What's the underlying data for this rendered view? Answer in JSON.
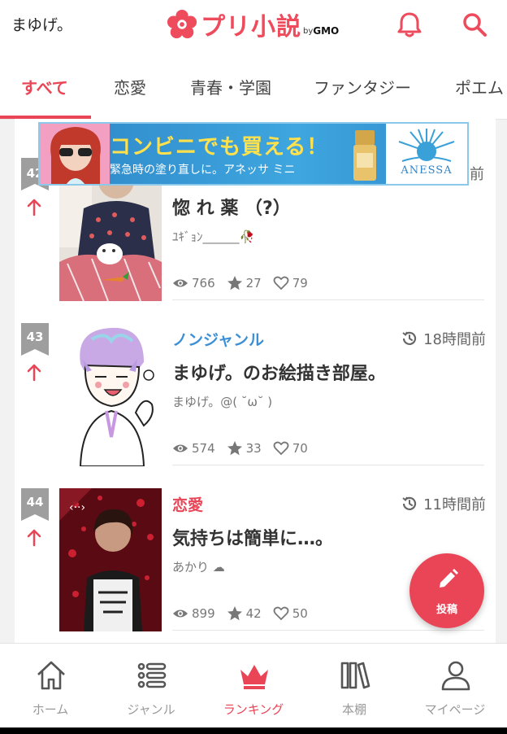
{
  "header": {
    "user_name": "まゆげ。",
    "logo_text": "プリ小説",
    "logo_by": "by",
    "logo_gmo": "GMO",
    "icons": [
      "bell-icon",
      "search-icon"
    ]
  },
  "tabs": [
    {
      "label": "すべて",
      "active": true
    },
    {
      "label": "恋愛"
    },
    {
      "label": "青春・学園"
    },
    {
      "label": "ファンタジー"
    },
    {
      "label": "ポエム"
    }
  ],
  "ad": {
    "headline": "コンビニでも買える！",
    "sub": "緊急時の塗り直しに。アネッサ ミニ",
    "brand": "ANESSA",
    "partial_time": "前"
  },
  "items": [
    {
      "rank": "42",
      "genre": "",
      "time": "",
      "title": "惚 れ 薬 （?）",
      "author": "ﾕｷﾞｮﾝ______🥀",
      "views": "766",
      "stars": "27",
      "likes": "79"
    },
    {
      "rank": "43",
      "genre": "ノンジャンル",
      "genre_color": "#3b8fd6",
      "time": "18時間前",
      "title": "まゆげ。のお絵描き部屋。",
      "author": "まゆげ。@( ˘ω˘ )",
      "views": "574",
      "stars": "33",
      "likes": "70"
    },
    {
      "rank": "44",
      "genre": "恋愛",
      "genre_color": "#e94556",
      "time": "11時間前",
      "title": "気持ちは簡単に…。",
      "author": "あかり ☁",
      "views": "899",
      "stars": "42",
      "likes": "50"
    }
  ],
  "fab": {
    "label": "投稿"
  },
  "bottom_nav": [
    {
      "label": "ホーム",
      "icon": "home-icon"
    },
    {
      "label": "ジャンル",
      "icon": "list-icon"
    },
    {
      "label": "ランキング",
      "icon": "crown-icon",
      "active": true
    },
    {
      "label": "本棚",
      "icon": "bookshelf-icon"
    },
    {
      "label": "マイページ",
      "icon": "user-icon"
    }
  ],
  "colors": {
    "accent": "#e94556",
    "genre_blue": "#3b8fd6"
  }
}
